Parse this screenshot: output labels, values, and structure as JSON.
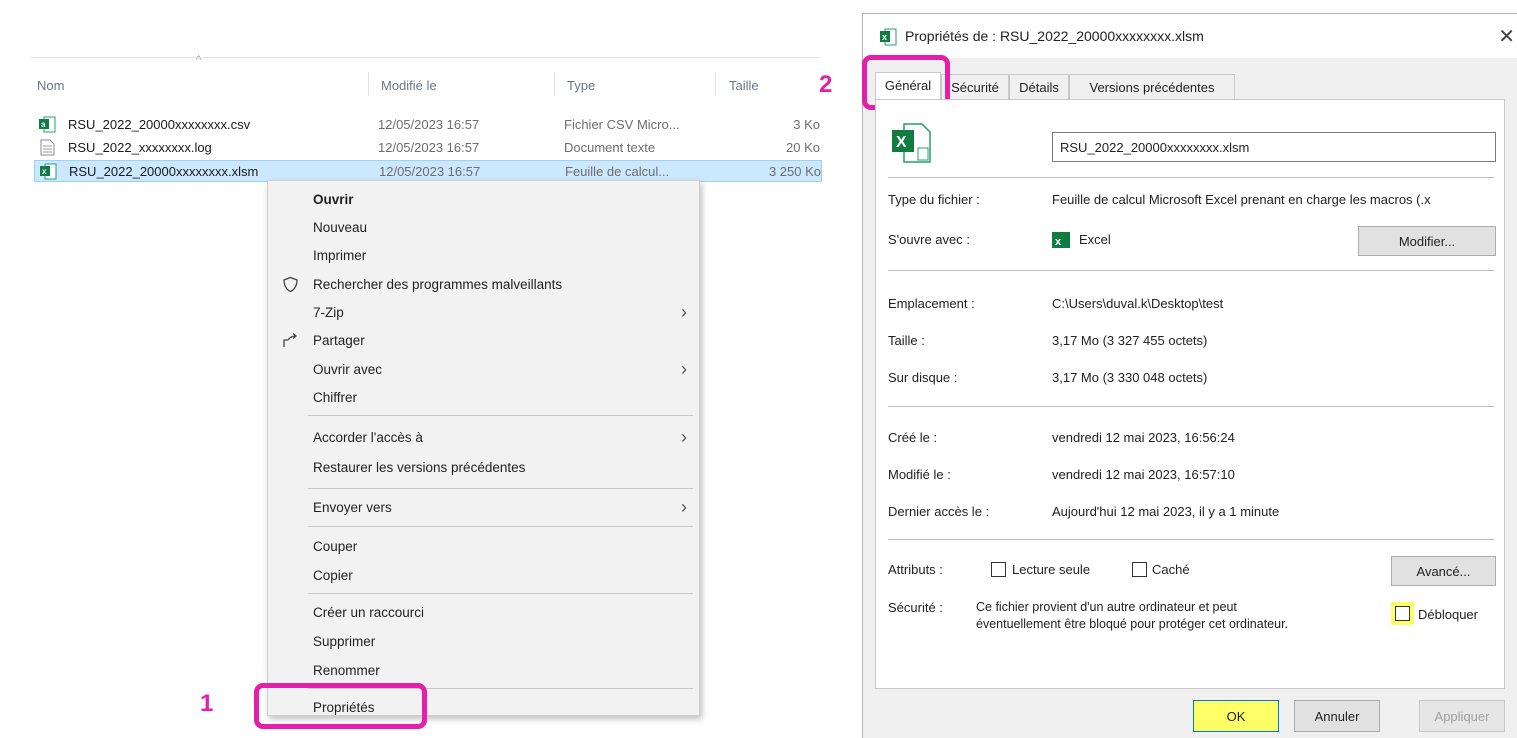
{
  "explorer": {
    "columns": {
      "name": "Nom",
      "modified": "Modifié le",
      "type": "Type",
      "size": "Taille"
    },
    "files": [
      {
        "name": "RSU_2022_20000xxxxxxxx.csv",
        "modified": "12/05/2023 16:57",
        "type": "Fichier CSV Micro...",
        "size": "3 Ko",
        "icon": "excel-csv-icon"
      },
      {
        "name": "RSU_2022_xxxxxxxx.log",
        "modified": "12/05/2023 16:57",
        "type": "Document texte",
        "size": "20 Ko",
        "icon": "text-file-icon"
      },
      {
        "name": "RSU_2022_20000xxxxxxxx.xlsm",
        "modified": "12/05/2023 16:57",
        "type": "Feuille de calcul...",
        "size": "3 250 Ko",
        "icon": "excel-xlsm-icon"
      }
    ]
  },
  "context_menu": {
    "items": [
      {
        "label": "Ouvrir",
        "bold": true
      },
      {
        "label": "Nouveau"
      },
      {
        "label": "Imprimer"
      },
      {
        "label": "Rechercher des programmes malveillants",
        "icon": "shield-icon"
      },
      {
        "label": "7-Zip",
        "submenu": true
      },
      {
        "label": "Partager",
        "icon": "share-icon"
      },
      {
        "label": "Ouvrir avec",
        "submenu": true
      },
      {
        "label": "Chiffrer"
      },
      {
        "label": "Accorder l'accès à",
        "submenu": true
      },
      {
        "label": "Restaurer les versions précédentes"
      },
      {
        "label": "Envoyer vers",
        "submenu": true
      },
      {
        "label": "Couper"
      },
      {
        "label": "Copier"
      },
      {
        "label": "Créer un raccourci"
      },
      {
        "label": "Supprimer"
      },
      {
        "label": "Renommer"
      },
      {
        "label": "Propriétés"
      }
    ],
    "submenu_glyph": "›"
  },
  "annotations": {
    "step1": "1",
    "step2": "2",
    "highlight_color": "#e61fa8",
    "yellow_highlight": "#ffff66"
  },
  "dialog": {
    "title": "Propriétés de : RSU_2022_20000xxxxxxxx.xlsm",
    "close_glyph": "✕",
    "tabs": [
      "Général",
      "Sécurité",
      "Détails",
      "Versions précédentes"
    ],
    "filename": "RSU_2022_20000xxxxxxxx.xlsm",
    "type_label": "Type du fichier :",
    "type_value": "Feuille de calcul Microsoft Excel prenant en charge les macros (.x",
    "opens_label": "S'ouvre avec :",
    "opens_value": "Excel",
    "modify_btn": "Modifier...",
    "location_label": "Emplacement :",
    "location_value": "C:\\Users\\duval.k\\Desktop\\test",
    "size_label": "Taille :",
    "size_value": "3,17 Mo (3 327 455 octets)",
    "disk_label": "Sur disque :",
    "disk_value": "3,17 Mo (3 330 048 octets)",
    "created_label": "Créé le :",
    "created_value": "vendredi 12 mai 2023, 16:56:24",
    "modified_label": "Modifié le :",
    "modified_value": "vendredi 12 mai 2023, 16:57:10",
    "accessed_label": "Dernier accès le :",
    "accessed_value": "Aujourd'hui 12 mai 2023, il y a 1 minute",
    "attr_label": "Attributs :",
    "readonly_label": "Lecture seule",
    "hidden_label": "Caché",
    "advanced_btn": "Avancé...",
    "security_label": "Sécurité :",
    "security_text_1": "Ce fichier provient d'un autre ordinateur et peut",
    "security_text_2": "éventuellement être bloqué pour protéger cet ordinateur.",
    "unblock_label": "Débloquer",
    "ok_btn": "OK",
    "cancel_btn": "Annuler",
    "apply_btn": "Appliquer"
  }
}
